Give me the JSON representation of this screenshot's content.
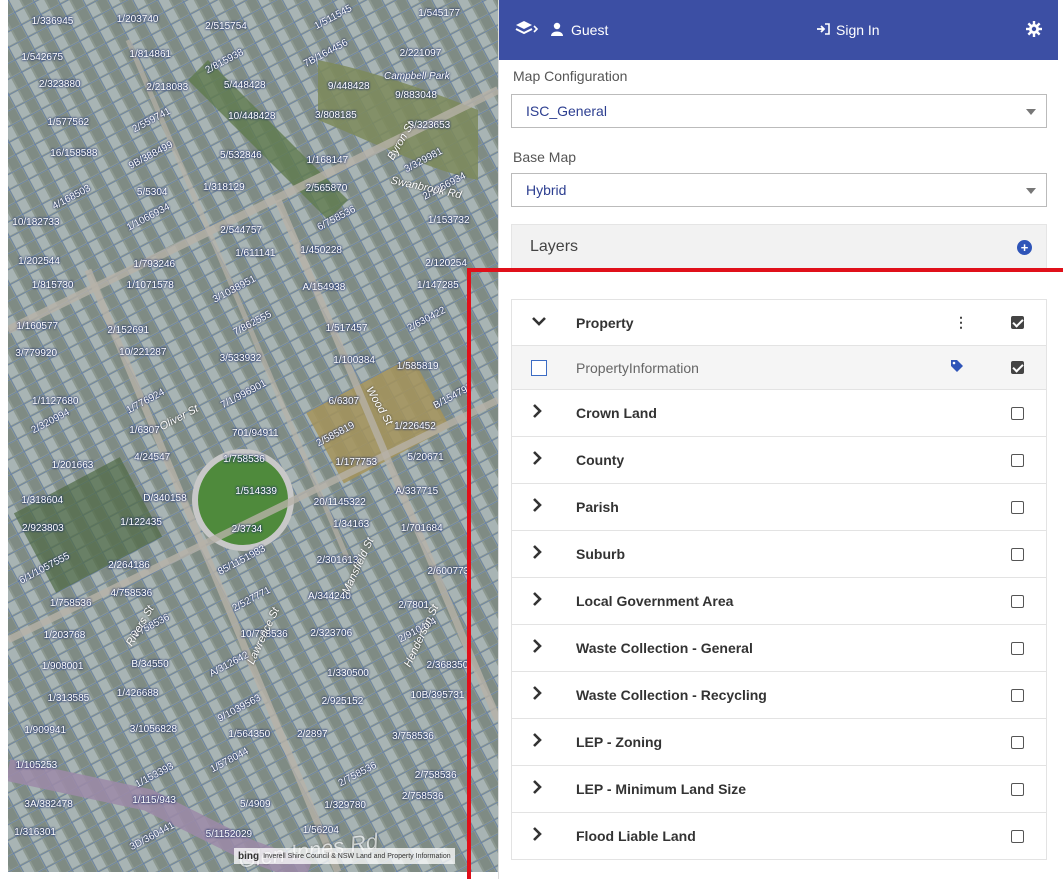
{
  "map": {
    "parcel_labels": [
      "1/336945",
      "1/203740",
      "2/515754",
      "1/511545",
      "1/545177",
      "1/542675",
      "1/814861",
      "2/815938",
      "7B/164456",
      "2/221097",
      "2/323880",
      "2/218083",
      "5/448428",
      "9/448428",
      "9/883048",
      "1/577562",
      "2/559741",
      "10/448428",
      "3/808185",
      "3/323653",
      "16/158588",
      "9B/388499",
      "5/532846",
      "1/168147",
      "3/329981",
      "4/168503",
      "5/5304",
      "1/318129",
      "2/565870",
      "2/1066934",
      "10/182733",
      "1/1066934",
      "2/544757",
      "6/758536",
      "1/153732",
      "1/202544",
      "1/793246",
      "1/611141",
      "1/450228",
      "2/120254",
      "1/815730",
      "1/1071578",
      "3/1038951",
      "A/154938",
      "1/147285",
      "1/160577",
      "2/152691",
      "7/862555",
      "1/517457",
      "2/630422",
      "3/779920",
      "10/221287",
      "3/533932",
      "1/100384",
      "1/585819",
      "1/1127680",
      "1/776924",
      "7/1/996901",
      "6/6307",
      "B/154797",
      "2/320994",
      "1/6307",
      "701/94911",
      "2/585819",
      "1/226452",
      "1/201663",
      "4/24547",
      "1/758536",
      "1/177753",
      "5/20671",
      "1/318604",
      "D/340158",
      "1/514339",
      "20/1145322",
      "A/337715",
      "2/923803",
      "1/122435",
      "2/3734",
      "1/34163",
      "1/701684",
      "6/1/1057555",
      "2/264186",
      "85/1151983",
      "2/301613",
      "2/600773",
      "1/758536",
      "4/758536",
      "2/527771",
      "A/344240",
      "2/7801",
      "1/203768",
      "3/758536",
      "10/758536",
      "2/323706",
      "2/910404",
      "1/908001",
      "B/34550",
      "A/312642",
      "1/330500",
      "2/368350",
      "1/313585",
      "1/426688",
      "9/1039563",
      "2/925152",
      "10B/395731",
      "1/909941",
      "3/1056828",
      "1/564350",
      "2/2897",
      "3/758536",
      "1/105253",
      "1/153393",
      "1/578044",
      "2/758536",
      "2/758536",
      "3A/382478",
      "1/115/943",
      "5/4909",
      "1/329780",
      "2/758536",
      "1/316301",
      "3D/360441",
      "5/1152029",
      "1/56204"
    ],
    "streets": [
      "Byron St",
      "Swanbrook Rd",
      "Oliver St",
      "Wood St",
      "Henderson St",
      "Mansfield St",
      "Rivers St",
      "Lawrence St",
      "Glen Innes Rd",
      "Otto St",
      "Ross St"
    ],
    "park_label": "Campbell Park",
    "attribution": "Inverell Shire Council & NSW Land and Property Information",
    "bing_label": "bing"
  },
  "panel": {
    "guest_label": "Guest",
    "sign_in_label": "Sign In",
    "map_config_label": "Map Configuration",
    "map_config_value": "ISC_General",
    "base_map_label": "Base Map",
    "base_map_value": "Hybrid",
    "layers_title": "Layers",
    "layers": [
      {
        "name": "Property",
        "checked": true,
        "expanded": true
      },
      {
        "name": "PropertyInformation",
        "checked": true,
        "sub": true
      },
      {
        "name": "Crown Land",
        "checked": false
      },
      {
        "name": "County",
        "checked": false
      },
      {
        "name": "Parish",
        "checked": false
      },
      {
        "name": "Suburb",
        "checked": false
      },
      {
        "name": "Local Government Area",
        "checked": false
      },
      {
        "name": "Waste Collection - General",
        "checked": false
      },
      {
        "name": "Waste Collection - Recycling",
        "checked": false
      },
      {
        "name": "LEP - Zoning",
        "checked": false
      },
      {
        "name": "LEP - Minimum Land Size",
        "checked": false
      },
      {
        "name": "Flood Liable Land",
        "checked": false
      }
    ]
  },
  "colors": {
    "topbar": "#3c4fa4",
    "highlight": "#e0101a",
    "link_text": "#2c3e90"
  }
}
